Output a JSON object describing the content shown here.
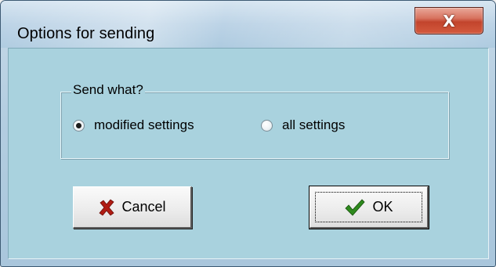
{
  "window": {
    "title": "Options for sending",
    "close_glyph": "X"
  },
  "group": {
    "legend": "Send what?",
    "options": [
      {
        "label": "modified settings",
        "selected": true
      },
      {
        "label": "all settings",
        "selected": false
      }
    ]
  },
  "buttons": {
    "cancel_label": "Cancel",
    "ok_label": "OK",
    "cancel_icon": "red-x-icon",
    "ok_icon": "green-check-icon",
    "cancel_icon_color": "#b01c14",
    "ok_icon_color": "#2e8a1e"
  },
  "colors": {
    "client_bg": "#a9d2de",
    "close_button": "#c2442c"
  }
}
